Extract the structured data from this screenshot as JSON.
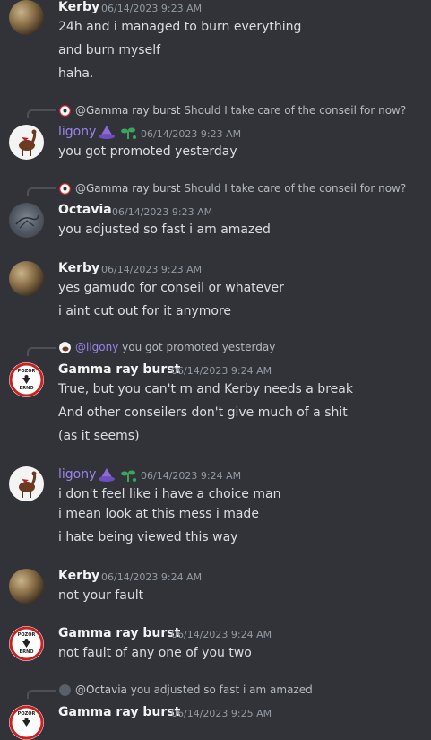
{
  "messages": [
    {
      "author": "Kerby",
      "timestamp": "06/14/2023 9:23 AM",
      "lines": [
        "24h and i managed to burn everything",
        "and burn myself",
        "haha."
      ]
    },
    {
      "reply_to": {
        "author": "@Gamma ray burst",
        "text": "Should I take care of the conseil for now?"
      },
      "author": "ligony",
      "timestamp": "06/14/2023 9:23 AM",
      "lines": [
        "you got promoted yesterday"
      ]
    },
    {
      "reply_to": {
        "author": "@Gamma ray burst",
        "text": "Should I take care of the conseil for now?"
      },
      "author": "Octavia",
      "timestamp": "06/14/2023 9:23 AM",
      "lines": [
        "you adjusted so fast i am amazed"
      ]
    },
    {
      "author": "Kerby",
      "timestamp": "06/14/2023 9:23 AM",
      "lines": [
        "yes gamudo for conseil or whatever",
        "i aint cut out for it anymore"
      ]
    },
    {
      "reply_to": {
        "author": "@ligony",
        "text": "you got promoted yesterday"
      },
      "author": "Gamma ray burst",
      "timestamp": "06/14/2023 9:24 AM",
      "lines": [
        "True, but you can't rn and Kerby needs a break",
        "And other conseilers don't give much of a shit",
        "(as it seems)"
      ]
    },
    {
      "author": "ligony",
      "timestamp": "06/14/2023 9:24 AM",
      "lines": [
        "i don't feel like i have a choice man",
        "i mean look at this mess i made",
        "i hate being viewed this way"
      ]
    },
    {
      "author": "Kerby",
      "timestamp": "06/14/2023 9:24 AM",
      "lines": [
        "not your fault"
      ]
    },
    {
      "author": "Gamma ray burst",
      "timestamp": "06/14/2023 9:24 AM",
      "lines": [
        "not fault of any one of you two"
      ]
    },
    {
      "reply_to": {
        "author": "@Octavia",
        "text": "you adjusted so fast i am amazed"
      },
      "author": "Gamma ray burst",
      "timestamp": "06/14/2023 9:25 AM",
      "lines": []
    }
  ],
  "avatar_text": {
    "gamma_top": "POZOR",
    "gamma_bottom": "BRNO"
  },
  "colors": {
    "background": "#313338",
    "text": "#dbdee1",
    "muted": "#949ba4",
    "ligony_name": "#9b84ec",
    "gamma_ring": "#cc1f1f"
  }
}
